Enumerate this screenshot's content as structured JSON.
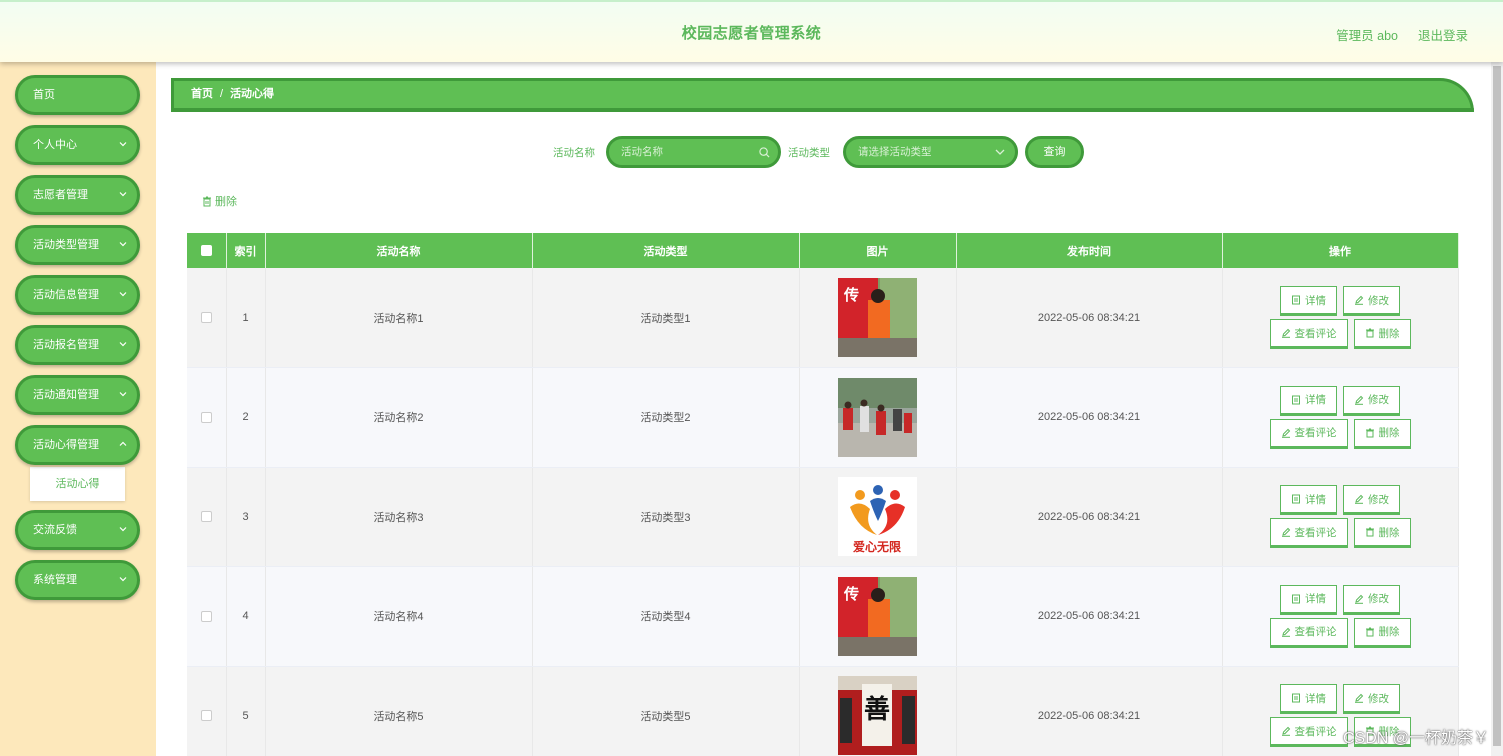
{
  "header": {
    "title": "校园志愿者管理系统",
    "user": "管理员 abo",
    "logout": "退出登录"
  },
  "sidebar": {
    "items": [
      {
        "label": "首页",
        "has_arrow": false
      },
      {
        "label": "个人中心",
        "has_arrow": true
      },
      {
        "label": "志愿者管理",
        "has_arrow": true
      },
      {
        "label": "活动类型管理",
        "has_arrow": true
      },
      {
        "label": "活动信息管理",
        "has_arrow": true
      },
      {
        "label": "活动报名管理",
        "has_arrow": true
      },
      {
        "label": "活动通知管理",
        "has_arrow": true
      },
      {
        "label": "活动心得管理",
        "has_arrow": true,
        "expanded": true
      },
      {
        "label": "交流反馈",
        "has_arrow": true
      },
      {
        "label": "系统管理",
        "has_arrow": true
      }
    ],
    "submenu": {
      "label": "活动心得"
    }
  },
  "breadcrumb": {
    "home": "首页",
    "separator": "/",
    "current": "活动心得"
  },
  "search": {
    "name_label": "活动名称",
    "name_placeholder": "活动名称",
    "type_label": "活动类型",
    "type_placeholder": "请选择活动类型",
    "query_button": "查询"
  },
  "toolbar": {
    "delete_label": "删除"
  },
  "table": {
    "columns": [
      "索引",
      "活动名称",
      "活动类型",
      "图片",
      "发布时间",
      "操作"
    ],
    "rows": [
      {
        "index": "1",
        "name": "活动名称1",
        "type": "活动类型1",
        "image": "volunteer-painting-photo",
        "time": "2022-05-06 08:34:21"
      },
      {
        "index": "2",
        "name": "活动名称2",
        "type": "活动类型2",
        "image": "volunteers-street-cleaning-photo",
        "time": "2022-05-06 08:34:21"
      },
      {
        "index": "3",
        "name": "活动名称3",
        "type": "活动类型3",
        "image": "love-unlimited-logo",
        "time": "2022-05-06 08:34:21"
      },
      {
        "index": "4",
        "name": "活动名称4",
        "type": "活动类型4",
        "image": "volunteer-painting-photo",
        "time": "2022-05-06 08:34:21"
      },
      {
        "index": "5",
        "name": "活动名称5",
        "type": "活动类型5",
        "image": "calligraphy-event-photo",
        "time": "2022-05-06 08:34:21"
      }
    ],
    "actions": {
      "detail": "详情",
      "edit": "修改",
      "comments": "查看评论",
      "delete": "删除"
    },
    "logo_text": "爱心无限"
  },
  "watermark": "CSDN @一杯奶茶￥",
  "colors": {
    "primary": "#5fbf54",
    "primary_border": "#3f9a3a",
    "text_green": "#5cb85c",
    "sidebar_bg": "#fde8bb"
  }
}
